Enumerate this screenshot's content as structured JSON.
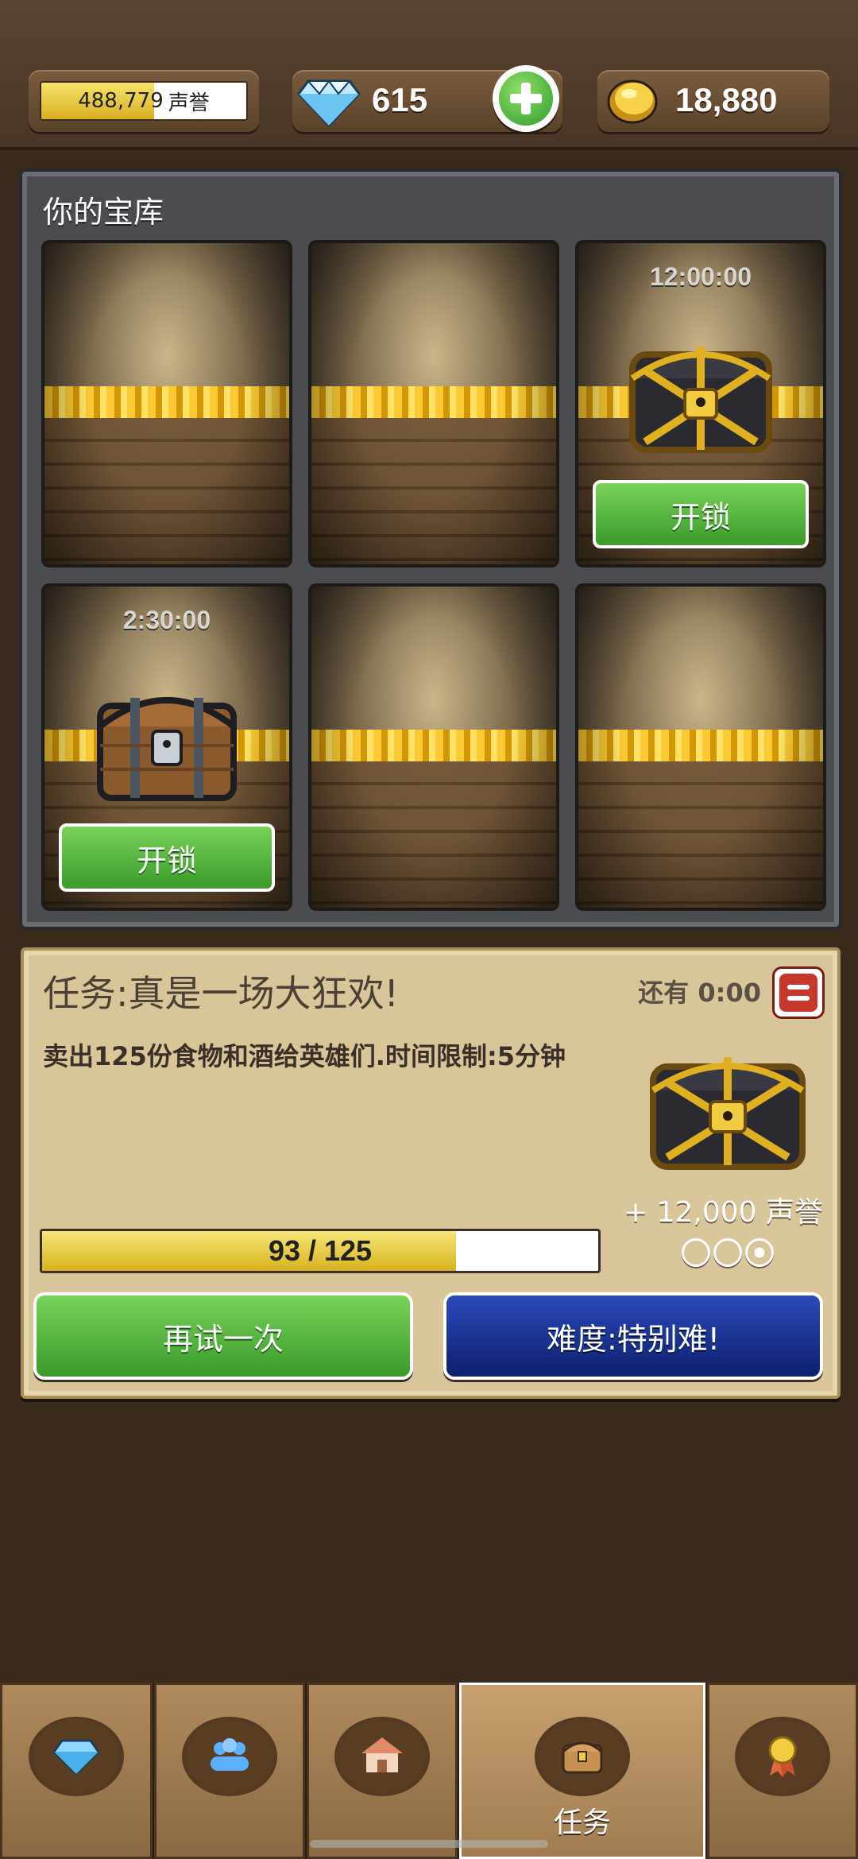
{
  "status": {
    "reputation_value": "488,779",
    "reputation_label": "声誉",
    "reputation_progress": 0.55,
    "gems": "615",
    "gold": "18,880"
  },
  "vault": {
    "title": "你的宝库",
    "slots": [
      {
        "timer": "",
        "chest": "",
        "button": ""
      },
      {
        "timer": "",
        "chest": "",
        "button": ""
      },
      {
        "timer": "12:00:00",
        "chest": "golden-chest",
        "button": "开锁"
      },
      {
        "timer": "2:30:00",
        "chest": "wooden-chest",
        "button": "开锁"
      },
      {
        "timer": "",
        "chest": "",
        "button": ""
      },
      {
        "timer": "",
        "chest": "",
        "button": ""
      }
    ]
  },
  "quest": {
    "title": "任务:真是一场大狂欢!",
    "remaining": "还有 0:00",
    "description": "卖出125份食物和酒给英雄们.时间限制:5分钟",
    "reward": "+ 12,000 声誉",
    "progress_text": "93 / 125",
    "progress_value": 93,
    "progress_max": 125,
    "difficulty_stars": [
      false,
      false,
      true
    ],
    "retry_label": "再试一次",
    "difficulty_label": "难度:特别难!"
  },
  "nav": {
    "items": [
      {
        "icon": "gem-icon",
        "label": ""
      },
      {
        "icon": "heroes-icon",
        "label": ""
      },
      {
        "icon": "shop-icon",
        "label": ""
      },
      {
        "icon": "chest-icon",
        "label": "任务",
        "active": true
      },
      {
        "icon": "medal-icon",
        "label": ""
      }
    ]
  },
  "colors": {
    "accent_green": "#3a9a2a",
    "accent_blue": "#0e1f6e",
    "wood": "#8a6a44"
  }
}
